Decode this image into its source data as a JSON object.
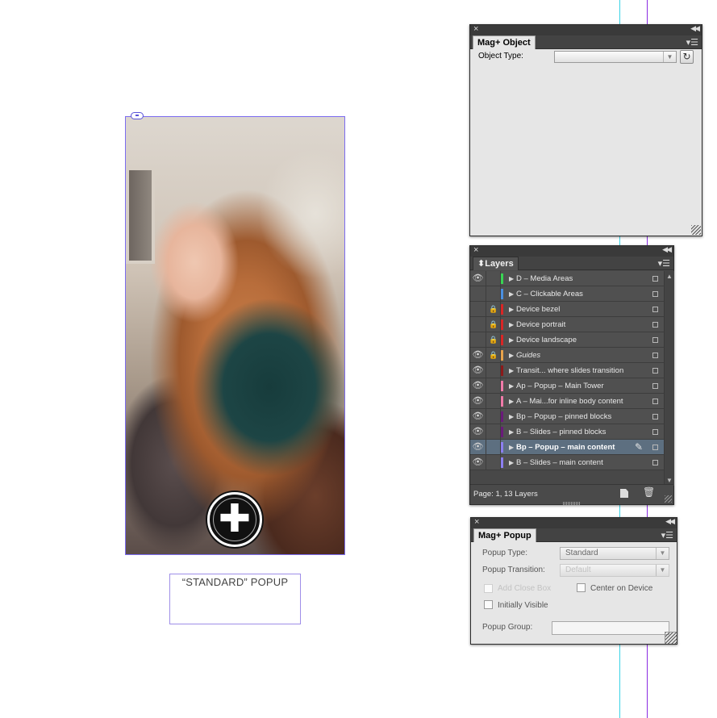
{
  "canvas": {
    "popup_label": "“STANDARD” POPUP"
  },
  "mag_object_panel": {
    "tab_label": "Mag+ Object",
    "object_type_label": "Object Type:",
    "object_type_value": ""
  },
  "layers_panel": {
    "tab_label": "Layers",
    "status": "Page: 1, 13 Layers",
    "layers": [
      {
        "name": "D – Media Areas",
        "visible": true,
        "locked": false,
        "color": "#39d353",
        "italic": false,
        "selected": false
      },
      {
        "name": "C – Clickable Areas",
        "visible": false,
        "locked": false,
        "color": "#4a8fe0",
        "italic": false,
        "selected": false
      },
      {
        "name": "Device bezel",
        "visible": false,
        "locked": true,
        "color": "#d92626",
        "italic": false,
        "selected": false
      },
      {
        "name": "Device portrait",
        "visible": false,
        "locked": true,
        "color": "#d92626",
        "italic": false,
        "selected": false
      },
      {
        "name": "Device landscape",
        "visible": false,
        "locked": true,
        "color": "#d92626",
        "italic": false,
        "selected": false
      },
      {
        "name": "Guides",
        "visible": true,
        "locked": true,
        "color": "#e8a24a",
        "italic": true,
        "selected": false
      },
      {
        "name": "Transit... where slides transition",
        "visible": true,
        "locked": false,
        "color": "#8b1a1a",
        "italic": false,
        "selected": false
      },
      {
        "name": "Ap – Popup – Main Tower",
        "visible": true,
        "locked": false,
        "color": "#f07aa8",
        "italic": false,
        "selected": false
      },
      {
        "name": "A – Mai...for inline body content",
        "visible": true,
        "locked": false,
        "color": "#f07aa8",
        "italic": false,
        "selected": false
      },
      {
        "name": "Bp – Popup – pinned blocks",
        "visible": true,
        "locked": false,
        "color": "#6a1b7a",
        "italic": false,
        "selected": false
      },
      {
        "name": "B – Slides – pinned blocks",
        "visible": true,
        "locked": false,
        "color": "#6a1b7a",
        "italic": false,
        "selected": false
      },
      {
        "name": "Bp – Popup – main content",
        "visible": true,
        "locked": false,
        "color": "#8c7ff0",
        "italic": false,
        "selected": true
      },
      {
        "name": "B – Slides – main content",
        "visible": true,
        "locked": false,
        "color": "#8c7ff0",
        "italic": false,
        "selected": false
      }
    ]
  },
  "mag_popup_panel": {
    "tab_label": "Mag+ Popup",
    "popup_type_label": "Popup Type:",
    "popup_type_value": "Standard",
    "popup_transition_label": "Popup Transition:",
    "popup_transition_value": "Default",
    "add_close_box_label": "Add Close Box",
    "center_on_device_label": "Center on Device",
    "initially_visible_label": "Initially Visible",
    "popup_group_label": "Popup Group:",
    "popup_group_value": ""
  },
  "icons": {
    "close": "close-icon",
    "collapse": "collapse-icon",
    "panel_menu": "panel-menu-icon",
    "eye": "eye-icon",
    "lock": "lock-icon",
    "pen": "pen-icon",
    "new_layer": "new-layer-icon",
    "trash": "trash-icon",
    "link": "link-icon",
    "plus": "plus-icon",
    "refresh": "refresh-icon"
  },
  "colors": {
    "guide_cyan": "#39d3e6",
    "guide_purple": "#8a2be2",
    "frame_border": "#7b6cf0",
    "selected_row": "#5d6f80"
  }
}
